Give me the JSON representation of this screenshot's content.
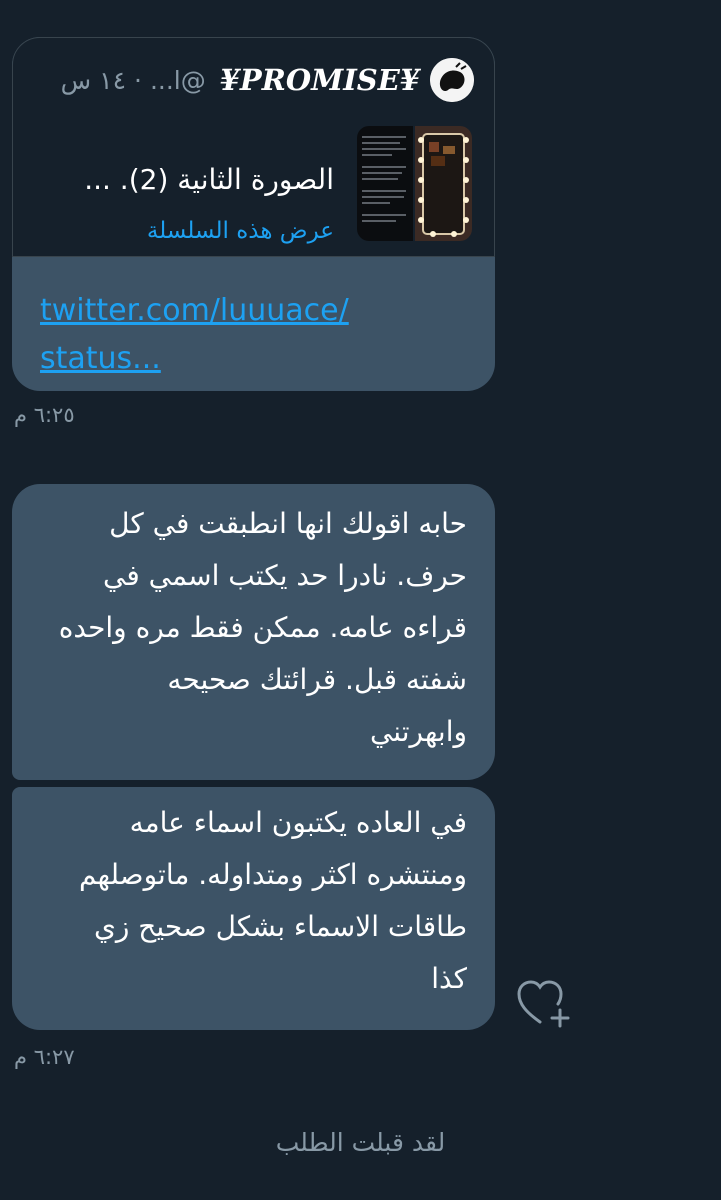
{
  "quoted_tweet": {
    "author_name": "¥PROMISE¥",
    "handle": "...l@",
    "separator": "·",
    "time_ago": "١٤ س",
    "text": "الصورة الثانية (2). ...",
    "thread_link": "عرض هذه السلسلة",
    "avatar_icon": "avatar-icon",
    "thumbnail_icon": "image-thumbnail-icon"
  },
  "link_message": {
    "url_line1": "twitter.com/luuuace/",
    "url_line2": "status..."
  },
  "timestamp_1": "٦:٢٥ م",
  "message_1": {
    "lines": [
      "حابه اقولك انها انطبقت في كل",
      "حرف. نادرا حد يكتب اسمي في",
      "قراءه عامه. ممكن فقط مره واحده",
      "شفته قبل. قرائتك صحيحه",
      "وابهرتني"
    ]
  },
  "message_2": {
    "lines": [
      "في العاده يكتبون اسماء عامه",
      "ومنتشره اكثر ومتداوله. ماتوصلهم",
      "طاقات الاسماء بشكل صحيح زي",
      "كذا"
    ]
  },
  "timestamp_2": "٦:٢٧ م",
  "footer_status": "لقد قبلت الطلب",
  "colors": {
    "background": "#15202b",
    "bubble": "#3d5366",
    "link": "#1da1f2",
    "muted": "#8899a6"
  },
  "icons": {
    "reaction": "heart-plus-icon"
  }
}
